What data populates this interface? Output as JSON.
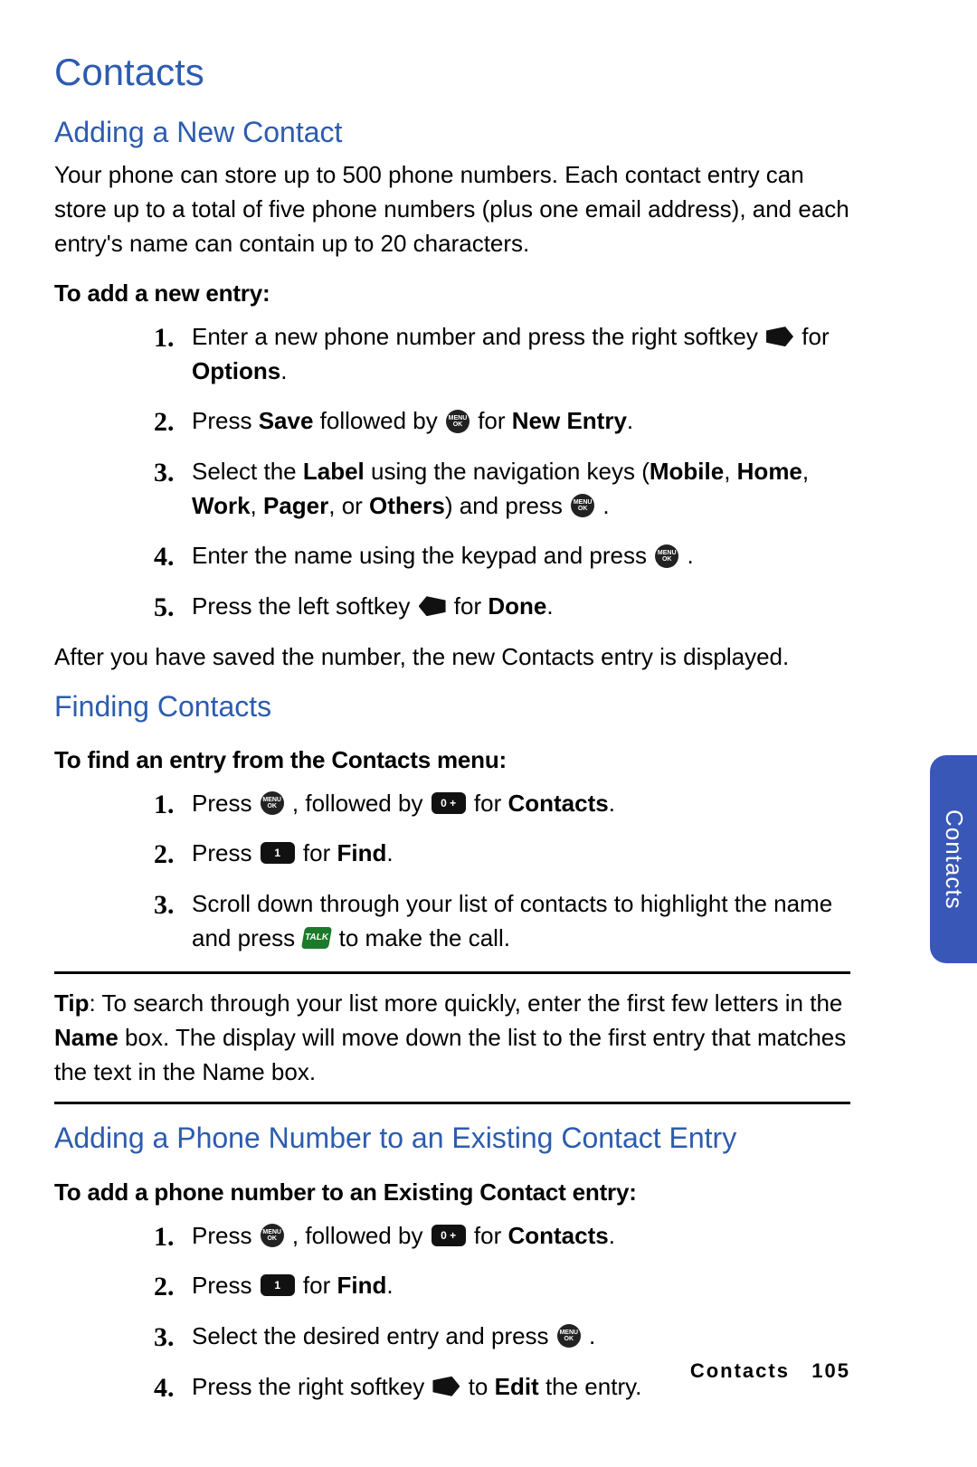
{
  "title": "Contacts",
  "section1": {
    "heading": "Adding a New Contact",
    "intro": "Your phone can store up to 500 phone numbers. Each contact entry can store up to a total of five phone numbers (plus one email address), and each entry's name can contain up to 20 characters.",
    "sub": "To add a new entry:",
    "steps": {
      "s1": {
        "a": "Enter a new phone number and press the right softkey ",
        "b": " for ",
        "c": "Options",
        "d": "."
      },
      "s2": {
        "a": "Press ",
        "b": "Save",
        "c": " followed by ",
        "d": " for ",
        "e": "New Entry",
        "f": "."
      },
      "s3": {
        "a": "Select the ",
        "b": "Label",
        "c": " using the navigation keys (",
        "d": "Mobile",
        "e": ", ",
        "f": "Home",
        "g": ", ",
        "h": "Work",
        "i": ", ",
        "j": "Pager",
        "k": ", or ",
        "l": "Others",
        "m": ") and press ",
        "n": "."
      },
      "s4": {
        "a": "Enter the name using the keypad and press ",
        "b": "."
      },
      "s5": {
        "a": "Press the left softkey ",
        "b": " for ",
        "c": "Done",
        "d": "."
      }
    },
    "after": "After you have saved the number, the new Contacts entry is displayed."
  },
  "section2": {
    "heading": "Finding Contacts",
    "sub": "To find an entry from the Contacts menu:",
    "steps": {
      "s1": {
        "a": "Press ",
        "b": ", followed by ",
        "c": " for ",
        "d": "Contacts",
        "e": "."
      },
      "s2": {
        "a": "Press ",
        "b": " for ",
        "c": "Find",
        "d": "."
      },
      "s3": {
        "a": "Scroll down through your list of contacts to highlight the name and press ",
        "b": " to make the call."
      }
    }
  },
  "tip": {
    "a": "Tip",
    "b": ": To search through your list more quickly, enter the first few letters in the ",
    "c": "Name",
    "d": " box. The display will move down the list to the first entry that matches the text in the Name box."
  },
  "section3": {
    "heading": "Adding a Phone Number to an Existing Contact Entry",
    "sub": "To add a phone number to an Existing Contact entry:",
    "steps": {
      "s1": {
        "a": "Press ",
        "b": ", followed by ",
        "c": " for ",
        "d": "Contacts",
        "e": "."
      },
      "s2": {
        "a": "Press ",
        "b": " for ",
        "c": "Find",
        "d": "."
      },
      "s3": {
        "a": "Select the desired entry and press ",
        "b": "."
      },
      "s4": {
        "a": "Press the right softkey ",
        "b": " to ",
        "c": "Edit",
        "d": " the entry."
      }
    }
  },
  "keylabels": {
    "zero": "0 +",
    "one": "1",
    "talk": "TALK"
  },
  "sidetab": "Contacts",
  "footer": {
    "section": "Contacts",
    "page": "105"
  }
}
